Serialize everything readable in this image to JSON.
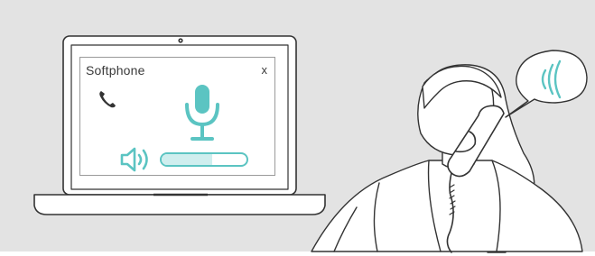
{
  "softphone": {
    "title": "Softphone",
    "close_label": "x",
    "volume_level": 0.6
  },
  "colors": {
    "accent": "#5bc4c2",
    "accent_fill": "#cfeeee",
    "background": "#e3e3e3",
    "outline": "#333333"
  },
  "icons": [
    "phone-handset-icon",
    "microphone-icon",
    "speaker-icon",
    "sound-waves-icon"
  ]
}
